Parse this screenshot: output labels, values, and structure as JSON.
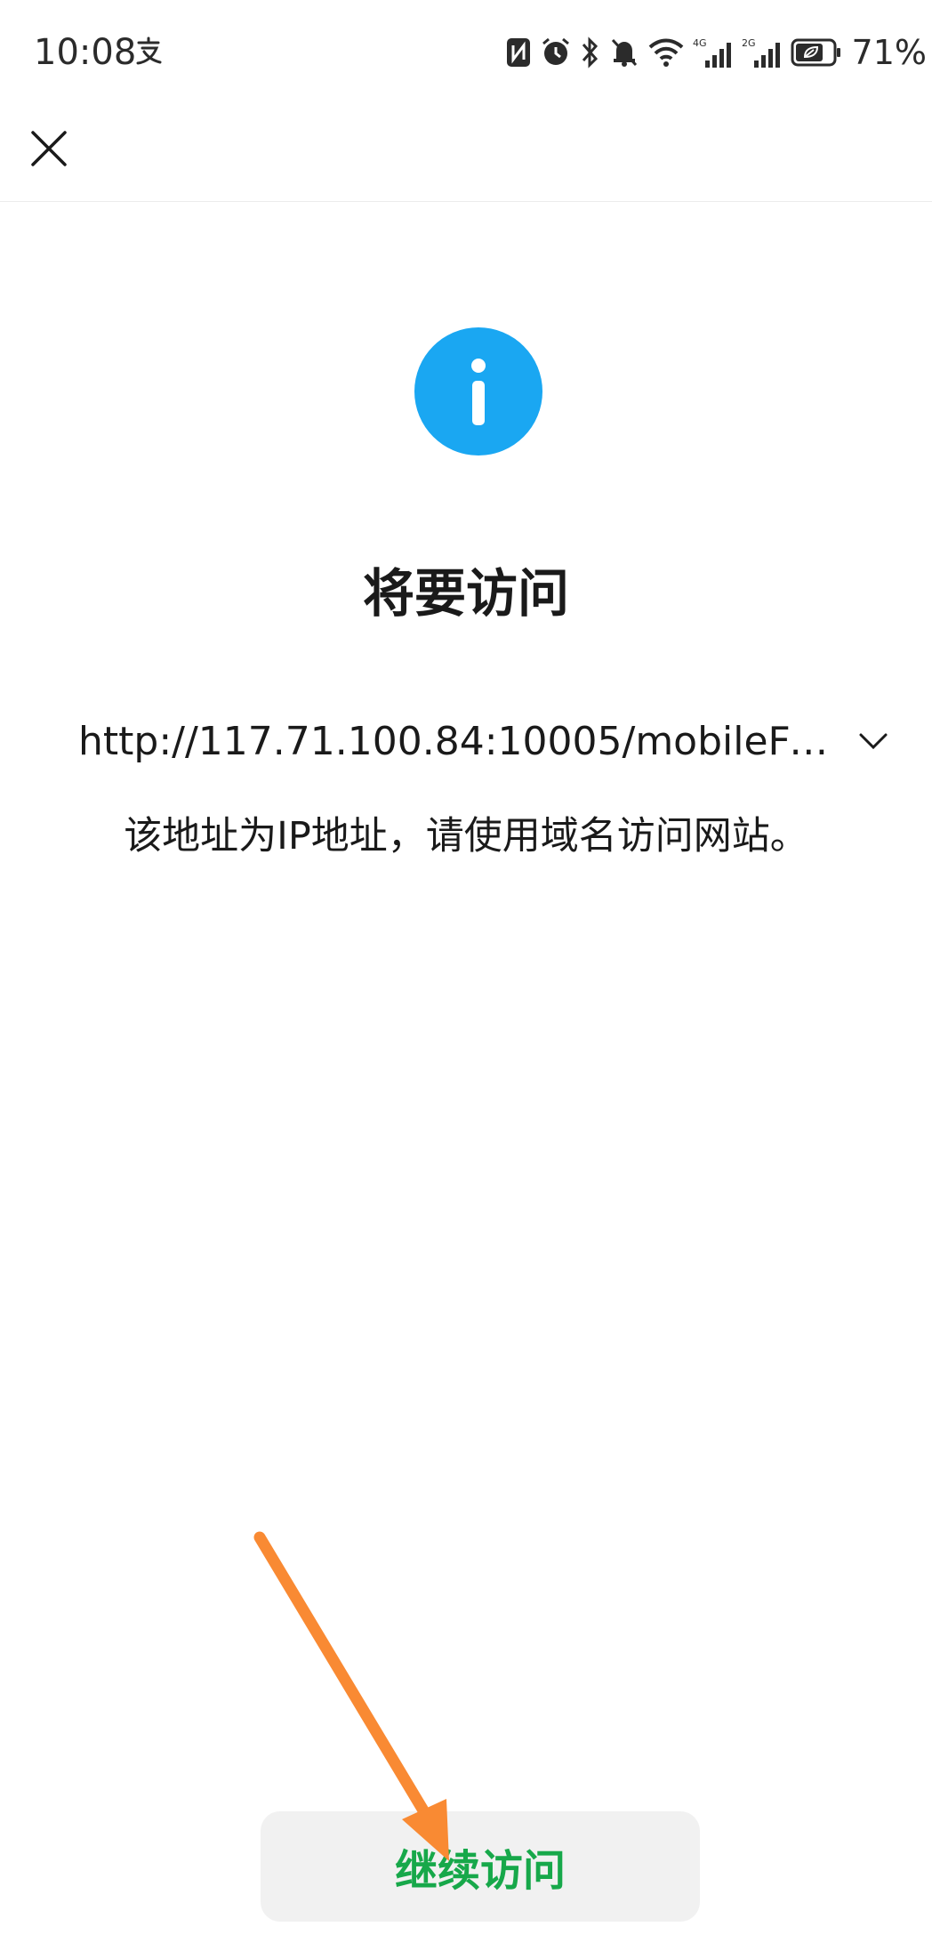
{
  "status_bar": {
    "time": "10:08",
    "battery_percent": "71%",
    "network_primary": "4G",
    "network_secondary": "2G",
    "icons": [
      "alipay-icon",
      "nfc-icon",
      "alarm-icon",
      "bluetooth-icon",
      "mute-icon",
      "wifi-icon",
      "signal-4g-icon",
      "signal-2g-icon",
      "battery-icon"
    ]
  },
  "top_bar": {
    "close_icon": "close-icon"
  },
  "dialog": {
    "icon": "info-icon",
    "title": "将要访问",
    "url": "http://117.71.100.84:10005/mobileForm...",
    "message": "该地址为IP地址，请使用域名访问网站。",
    "continue_label": "继续访问"
  },
  "colors": {
    "info_blue": "#1aa7f2",
    "continue_green": "#17a84a",
    "button_bg": "#f1f1f1",
    "annotation_orange": "#f98a33"
  }
}
